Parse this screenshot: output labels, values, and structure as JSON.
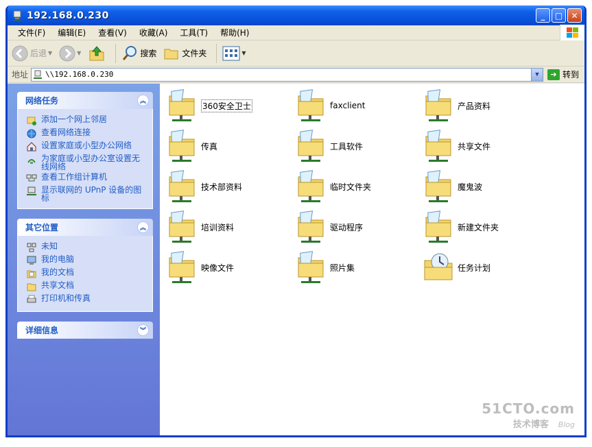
{
  "window": {
    "title": "192.168.0.230"
  },
  "menu": [
    "文件(F)",
    "编辑(E)",
    "查看(V)",
    "收藏(A)",
    "工具(T)",
    "帮助(H)"
  ],
  "toolbar": {
    "back": "后退",
    "search": "搜索",
    "folders": "文件夹"
  },
  "address": {
    "label": "地址",
    "value": "\\\\192.168.0.230",
    "go": "转到"
  },
  "sidebar": {
    "network_tasks": {
      "title": "网络任务",
      "items": [
        {
          "label": "添加一个网上邻居",
          "icon": "add-network-place-icon"
        },
        {
          "label": "查看网络连接",
          "icon": "network-connections-icon"
        },
        {
          "label": "设置家庭或小型办公网络",
          "icon": "home-network-icon"
        },
        {
          "label": "为家庭或小型办公室设置无线网络",
          "icon": "wireless-network-icon"
        },
        {
          "label": "查看工作组计算机",
          "icon": "workgroup-icon"
        },
        {
          "label": "显示联网的 UPnP 设备的图标",
          "icon": "upnp-icon"
        }
      ]
    },
    "other_places": {
      "title": "其它位置",
      "items": [
        {
          "label": "未知",
          "icon": "network-icon"
        },
        {
          "label": "我的电脑",
          "icon": "computer-icon"
        },
        {
          "label": "我的文档",
          "icon": "documents-icon"
        },
        {
          "label": "共享文档",
          "icon": "shared-folder-icon"
        },
        {
          "label": "打印机和传真",
          "icon": "printer-icon"
        }
      ]
    },
    "details": {
      "title": "详细信息"
    }
  },
  "files": [
    {
      "name": "360安全卫士",
      "type": "share"
    },
    {
      "name": "faxclient",
      "type": "share"
    },
    {
      "name": "产品资料",
      "type": "share"
    },
    {
      "name": "传真",
      "type": "share"
    },
    {
      "name": "工具软件",
      "type": "share"
    },
    {
      "name": "共享文件",
      "type": "share"
    },
    {
      "name": "技术部资料",
      "type": "share"
    },
    {
      "name": "临时文件夹",
      "type": "share"
    },
    {
      "name": "魔鬼波",
      "type": "share"
    },
    {
      "name": "培训资料",
      "type": "share"
    },
    {
      "name": "驱动程序",
      "type": "share"
    },
    {
      "name": "新建文件夹",
      "type": "share"
    },
    {
      "name": "映像文件",
      "type": "share"
    },
    {
      "name": "照片集",
      "type": "share"
    },
    {
      "name": "任务计划",
      "type": "tasks"
    }
  ],
  "watermark": {
    "top": "51CTO.com",
    "bottom": "技术博客",
    "blog": "Blog"
  }
}
